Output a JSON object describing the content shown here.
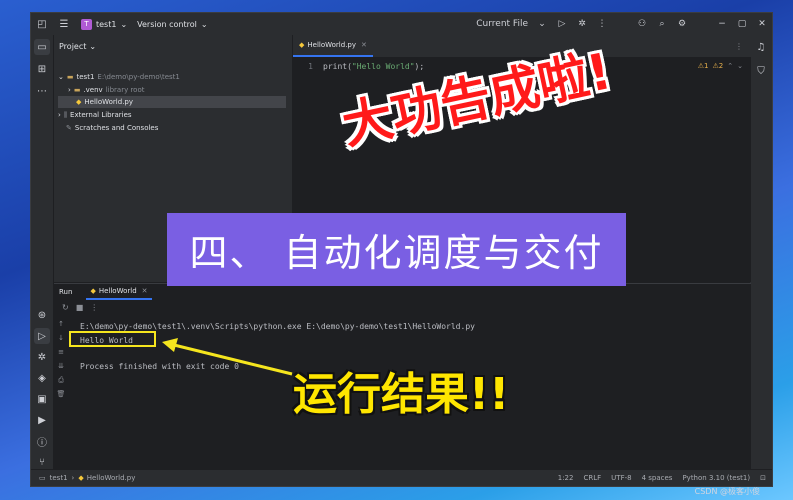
{
  "titlebar": {
    "project_badge": "T",
    "project_name": "test1",
    "vcs": "Version control",
    "run_config": "Current File",
    "icons": [
      "main-menu-icon",
      "hamburger-icon",
      "run-icon",
      "debug-icon",
      "more-icon",
      "account-icon",
      "search-icon",
      "settings-icon",
      "minimize-icon",
      "maximize-icon",
      "close-icon"
    ]
  },
  "project_panel": {
    "title": "Project",
    "tree": [
      {
        "label": "test1",
        "path": "E:\\demo\\py-demo\\test1"
      },
      {
        "label": ".venv",
        "path": "library root"
      },
      {
        "label": "HelloWorld.py",
        "path": ""
      },
      {
        "label": "External Libraries",
        "path": ""
      },
      {
        "label": "Scratches and Consoles",
        "path": ""
      }
    ]
  },
  "editor": {
    "tab": "HelloWorld.py",
    "line_number": "1",
    "code_fn": "print(",
    "code_str": "\"Hello World\"",
    "code_end": ");",
    "warnings": "⚠1",
    "weak_warnings": "⚠2"
  },
  "run_panel": {
    "title": "Run",
    "tab": "HelloWorld",
    "command": "E:\\demo\\py-demo\\test1\\.venv\\Scripts\\python.exe E:\\demo\\py-demo\\test1\\HelloWorld.py",
    "output": "Hello World",
    "finish": "Process finished with exit code 0"
  },
  "statusbar": {
    "project": "test1",
    "file": "HelloWorld.py",
    "position": "1:22",
    "line_sep": "CRLF",
    "encoding": "UTF-8",
    "indent": "4 spaces",
    "interpreter": "Python 3.10 (test1)"
  },
  "overlay": {
    "purple_banner": "四、 自动化调度与交付",
    "success_text": "大功告成啦!",
    "result_text": "运行结果!!"
  },
  "watermark": "CSDN @极客小俊",
  "colors": {
    "accent": "#3574f0",
    "string": "#6aab73",
    "banner": "#7a5fe3",
    "highlight": "#f5e51e",
    "red": "#ff1a1a"
  }
}
